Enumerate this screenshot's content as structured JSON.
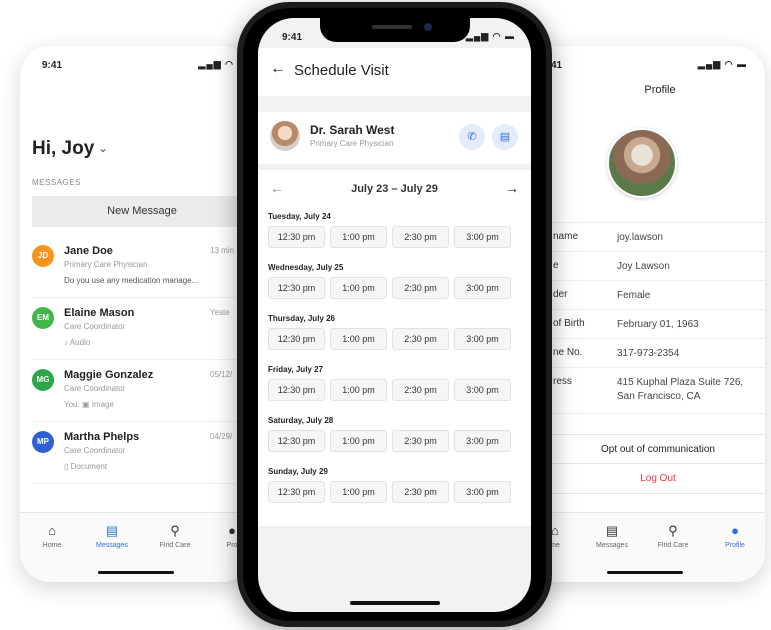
{
  "left_phone": {
    "time": "9:41",
    "greeting": "Hi, Joy",
    "section_label": "MESSAGES",
    "new_message_label": "New Message",
    "messages": [
      {
        "initials": "JD",
        "color": "#f7941d",
        "name": "Jane Doe",
        "role": "Primary Care Physician",
        "preview": "Do you use any medication manage...",
        "time": "13 min",
        "preview_icon": ""
      },
      {
        "initials": "EM",
        "color": "#43b649",
        "name": "Elaine Mason",
        "role": "Care Coordinator",
        "preview": "Audio",
        "time": "Yeste",
        "preview_icon": "audio-icon"
      },
      {
        "initials": "MG",
        "color": "#2aa84a",
        "name": "Maggie Gonzalez",
        "role": "Care Coordinator",
        "preview": "You: ▣ Image",
        "time": "05/12/",
        "preview_icon": "image-icon"
      },
      {
        "initials": "MP",
        "color": "#2f5fd0",
        "name": "Martha Phelps",
        "role": "Care Coordinator",
        "preview": "Document",
        "time": "04/29/",
        "preview_icon": "document-icon"
      }
    ],
    "tabs": [
      {
        "label": "Home",
        "icon": "home-icon"
      },
      {
        "label": "Messages",
        "icon": "messages-icon",
        "active": true
      },
      {
        "label": "Find Care",
        "icon": "search-icon"
      },
      {
        "label": "Pro",
        "icon": "profile-icon"
      }
    ]
  },
  "center_phone": {
    "time": "9:41",
    "title": "Schedule Visit",
    "doctor_name": "Dr. Sarah West",
    "doctor_role": "Primary Care Physician",
    "week_range": "July 23 – July 29",
    "accent": "#2f6fdc",
    "days": [
      {
        "label": "Tuesday, July 24",
        "slots": [
          "12:30 pm",
          "1:00 pm",
          "2:30 pm",
          "3:00 pm"
        ]
      },
      {
        "label": "Wednesday, July 25",
        "slots": [
          "12:30 pm",
          "1:00 pm",
          "2:30 pm",
          "3:00 pm"
        ]
      },
      {
        "label": "Thursday, July 26",
        "slots": [
          "12:30 pm",
          "1:00 pm",
          "2:30 pm",
          "3:00 pm"
        ]
      },
      {
        "label": "Friday, July 27",
        "slots": [
          "12:30 pm",
          "1:00 pm",
          "2:30 pm",
          "3:00 pm"
        ]
      },
      {
        "label": "Saturday, July 28",
        "slots": [
          "12:30 pm",
          "1:00 pm",
          "2:30 pm",
          "3:00 pm"
        ]
      },
      {
        "label": "Sunday, July 29",
        "slots": [
          "12:30 pm",
          "1:00 pm",
          "2:30 pm",
          "3:00 pm"
        ]
      }
    ]
  },
  "right_phone": {
    "time": "41",
    "title": "Profile",
    "fields": [
      {
        "key": "name",
        "value": "joy.lawson"
      },
      {
        "key": "e",
        "value": "Joy Lawson"
      },
      {
        "key": "der",
        "value": "Female"
      },
      {
        "key": "of Birth",
        "value": "February 01, 1963"
      },
      {
        "key": "ne No.",
        "value": "317-973-2354"
      },
      {
        "key": "ress",
        "value": "415 Kuphal Plaza Suite 726, San Francisco, CA"
      }
    ],
    "opt_out_label": "Opt out of communication",
    "logout_label": "Log Out",
    "logout_color": "#e53935",
    "tabs": [
      {
        "label": "me",
        "icon": "home-icon"
      },
      {
        "label": "Messages",
        "icon": "messages-icon"
      },
      {
        "label": "Find Care",
        "icon": "search-icon"
      },
      {
        "label": "Profile",
        "icon": "profile-icon",
        "active": true
      }
    ]
  }
}
